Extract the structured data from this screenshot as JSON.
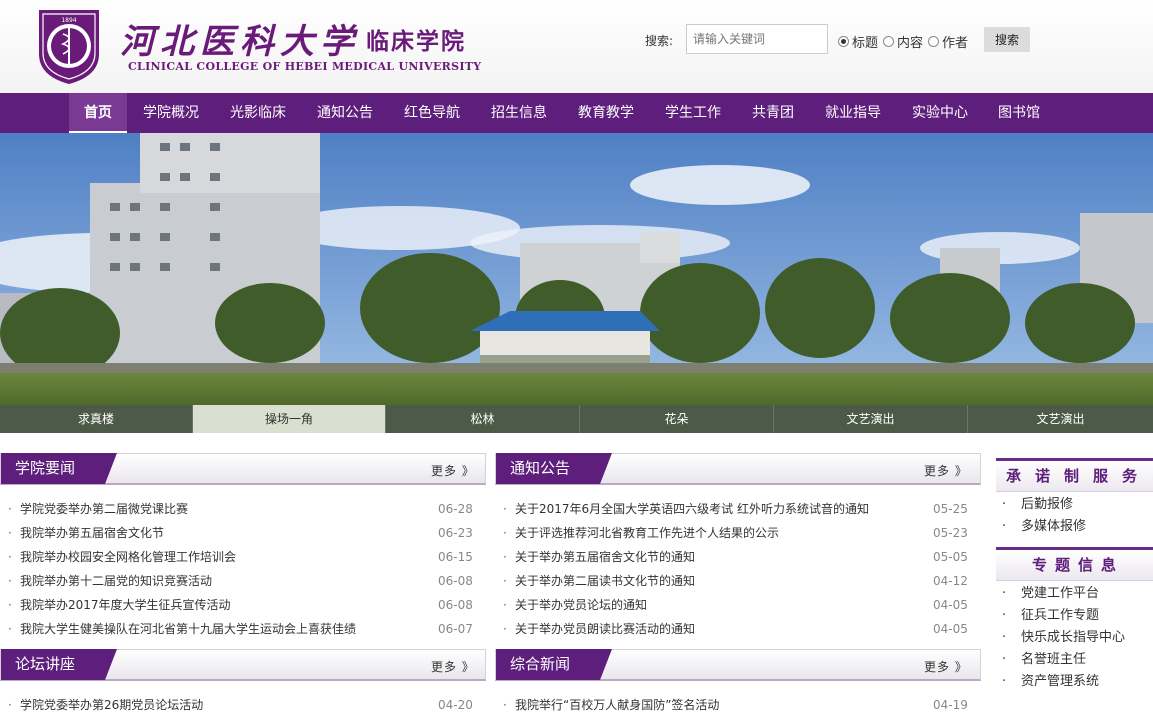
{
  "header": {
    "logo_cn": "河北医科大学",
    "logo_cn_sub": "临床学院",
    "logo_en": "CLINICAL COLLEGE OF HEBEI MEDICAL UNIVERSITY",
    "seal_text": "河北医科大学",
    "seal_year": "1894",
    "seal_en": "HEBEI MEDICAL UNIVERSITY"
  },
  "search": {
    "label": "搜索:",
    "placeholder": "请输入关键词",
    "options": [
      "标题",
      "内容",
      "作者"
    ],
    "selected": "标题",
    "button_label": "搜索"
  },
  "nav": {
    "items": [
      "首页",
      "学院概况",
      "光影临床",
      "通知公告",
      "红色导航",
      "招生信息",
      "教育教学",
      "学生工作",
      "共青团",
      "就业指导",
      "实验中心",
      "图书馆"
    ],
    "active": "首页"
  },
  "banner": {
    "thumbs": [
      "求真楼",
      "操场一角",
      "松林",
      "花朵",
      "文艺演出",
      "文艺演出"
    ],
    "active_index": 1
  },
  "panels": {
    "college_news": {
      "title": "学院要闻",
      "more": "更多 》",
      "items": [
        {
          "title": "学院党委举办第二届微党课比赛",
          "date": "06-28"
        },
        {
          "title": "我院举办第五届宿舍文化节",
          "date": "06-23"
        },
        {
          "title": "我院举办校园安全网格化管理工作培训会",
          "date": "06-15"
        },
        {
          "title": "我院举办第十二届党的知识竞赛活动",
          "date": "06-08"
        },
        {
          "title": "我院举办2017年度大学生征兵宣传活动",
          "date": "06-08"
        },
        {
          "title": "我院大学生健美操队在河北省第十九届大学生运动会上喜获佳绩",
          "date": "06-07"
        }
      ]
    },
    "notices": {
      "title": "通知公告",
      "more": "更多 》",
      "items": [
        {
          "title": "关于2017年6月全国大学英语四六级考试 红外听力系统试音的通知",
          "date": "05-25"
        },
        {
          "title": "关于评选推荐河北省教育工作先进个人结果的公示",
          "date": "05-23"
        },
        {
          "title": "关于举办第五届宿舍文化节的通知",
          "date": "05-05"
        },
        {
          "title": "关于举办第二届读书文化节的通知",
          "date": "04-12"
        },
        {
          "title": "关于举办党员论坛的通知",
          "date": "04-05"
        },
        {
          "title": "关于举办党员朗读比赛活动的通知",
          "date": "04-05"
        }
      ]
    },
    "forum": {
      "title": "论坛讲座",
      "more": "更多 》",
      "items": [
        {
          "title": "学院党委举办第26期党员论坛活动",
          "date": "04-20"
        }
      ]
    },
    "general_news": {
      "title": "综合新闻",
      "more": "更多 》",
      "items": [
        {
          "title": "我院举行“百校万人献身国防”签名活动",
          "date": "04-19"
        }
      ]
    }
  },
  "side": {
    "service": {
      "title": "承诺制服务",
      "items": [
        "后勤报修",
        "多媒体报修"
      ]
    },
    "topics": {
      "title": "专题信息",
      "items": [
        "党建工作平台",
        "征兵工作专题",
        "快乐成长指导中心",
        "名誉班主任",
        "资产管理系统"
      ]
    }
  },
  "colors": {
    "brand_purple": "#5e1e7c",
    "accent_purple": "#6a1b7a"
  }
}
